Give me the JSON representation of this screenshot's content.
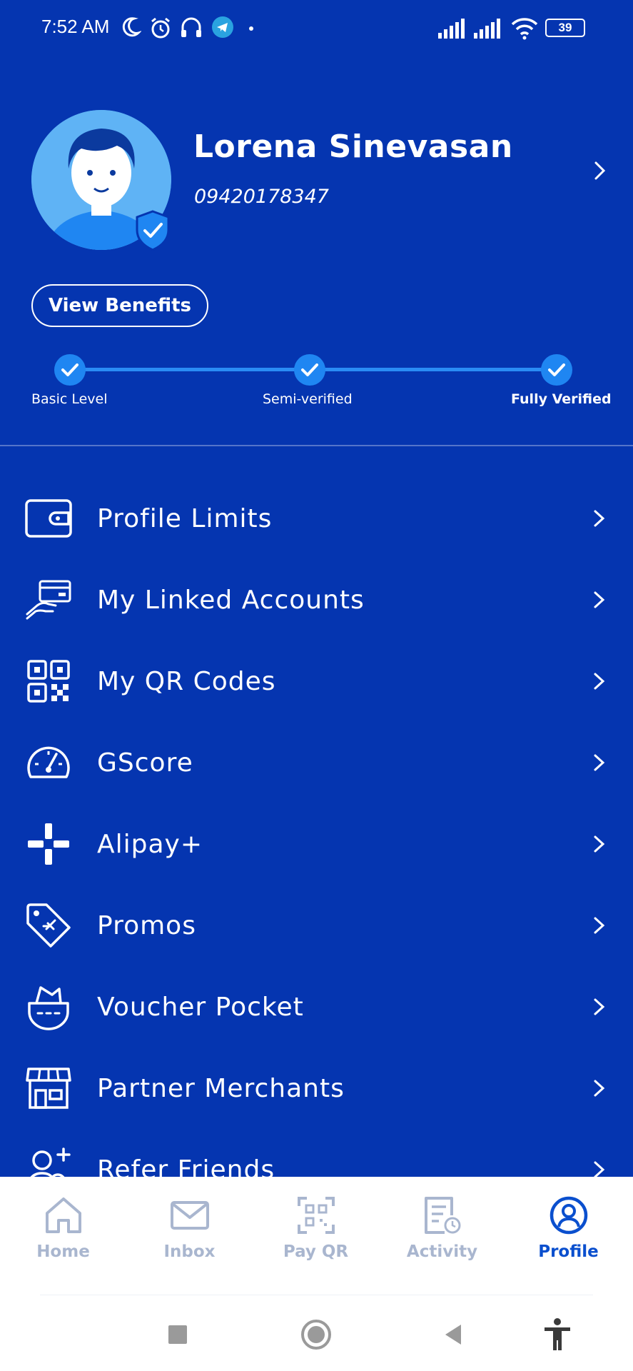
{
  "status_bar": {
    "time": "7:52 AM",
    "battery": "39",
    "icons": [
      "moon-icon",
      "alarm-icon",
      "headphones-icon",
      "telegram-icon",
      "signal-icon",
      "wifi-icon",
      "battery-icon"
    ]
  },
  "profile": {
    "name": "Lorena Sinevasan",
    "phone": "09420178347",
    "benefits_button": "View Benefits"
  },
  "verification": {
    "steps": [
      {
        "label": "Basic Level",
        "done": true
      },
      {
        "label": "Semi-verified",
        "done": true
      },
      {
        "label": "Fully Verified",
        "done": true,
        "current": true
      }
    ]
  },
  "menu": {
    "items": [
      {
        "label": "Profile Limits",
        "icon": "wallet-icon"
      },
      {
        "label": "My Linked Accounts",
        "icon": "linked-card-icon"
      },
      {
        "label": "My QR Codes",
        "icon": "qr-code-icon"
      },
      {
        "label": "GScore",
        "icon": "gauge-icon"
      },
      {
        "label": "Alipay+",
        "icon": "alipay-plus-icon"
      },
      {
        "label": "Promos",
        "icon": "tag-icon"
      },
      {
        "label": "Voucher Pocket",
        "icon": "voucher-pocket-icon"
      },
      {
        "label": "Partner Merchants",
        "icon": "storefront-icon"
      },
      {
        "label": "Refer Friends",
        "icon": "add-user-icon"
      }
    ]
  },
  "bottom_nav": {
    "items": [
      {
        "label": "Home",
        "icon": "home-icon",
        "active": false
      },
      {
        "label": "Inbox",
        "icon": "mail-icon",
        "active": false
      },
      {
        "label": "Pay QR",
        "icon": "scan-qr-icon",
        "active": false
      },
      {
        "label": "Activity",
        "icon": "activity-icon",
        "active": false
      },
      {
        "label": "Profile",
        "icon": "profile-icon",
        "active": true
      }
    ]
  },
  "colors": {
    "background": "#0535b0",
    "step_blue": "#1f86f2",
    "nav_active": "#0a4fce",
    "nav_inactive": "#a9b6cf"
  }
}
